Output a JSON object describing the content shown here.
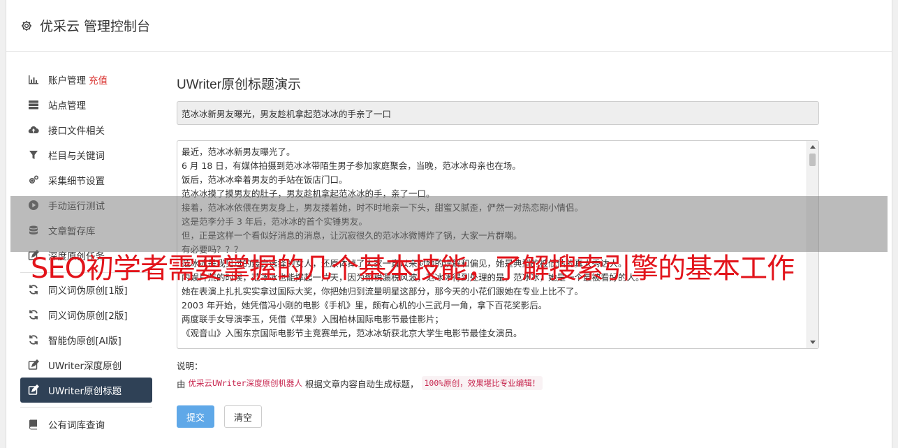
{
  "header": {
    "title": "优采云 管理控制台"
  },
  "sidebar": {
    "items": [
      {
        "label": "账户管理",
        "extra": "充值",
        "icon": "bar-chart-icon"
      },
      {
        "label": "站点管理",
        "icon": "server-icon"
      },
      {
        "label": "接口文件相关",
        "icon": "cloud-upload-icon"
      },
      {
        "label": "栏目与关键词",
        "icon": "filter-icon"
      },
      {
        "label": "采集细节设置",
        "icon": "gears-icon"
      },
      {
        "label": "手动运行测试",
        "icon": "play-circle-icon"
      },
      {
        "label": "文章暂存库",
        "icon": "database-icon"
      },
      {
        "label": "深度原创任务",
        "icon": "edit-icon"
      },
      {
        "label": "同义词伪原创[1版]",
        "icon": "refresh-icon"
      },
      {
        "label": "同义词伪原创[2版]",
        "icon": "refresh-icon"
      },
      {
        "label": "智能伪原创[AI版]",
        "icon": "refresh-icon"
      },
      {
        "label": "UWriter深度原创",
        "icon": "edit-icon"
      },
      {
        "label": "UWriter原创标题",
        "icon": "edit-icon",
        "active": true
      },
      {
        "label": "公有词库查询",
        "icon": "book-icon"
      }
    ]
  },
  "main": {
    "heading": "UWriter原创标题演示",
    "title_value": "范冰冰新男友曝光，男友趁机拿起范冰冰的手亲了一口",
    "body_lines": [
      "最近，范冰冰新男友曝光了。",
      "6 月 18 日，有媒体拍摄到范冰冰带陌生男子参加家庭聚会，当晚，范冰冰母亲也在场。",
      "饭后，范冰冰牵着男友的手站在饭店门口。",
      "范冰冰摸了摸男友的肚子，男友趁机拿起范冰冰的手，亲了一口。",
      "接着，范冰冰依偎在男友身上，男友搂着她，时不时地亲一下头，甜蜜又腻歪，俨然一对热恋期小情侣。",
      "这是范李分手 3 年后，范冰冰的首个实锤男友。",
      "但，正是这样一个看似好消息的消息，让沉寂很久的范冰冰微博炸了锅，大家一片群嘲。",
      "有必要吗？？？",
      "范冰冰是我见过的最会选择的女人，还原体掉了大家一直以来对她的误解和偏见，她是典型的被低估的真人秀达人。",
      "内娱片荒的时候，范冰冰也能撑起一片天，因为偷税漏税风波，范冰冰得到处理的是，范冰冰，她是一个最被看好的人。",
      "她在表演上扎扎实实拿过国际大奖，你把她归到流量明星这部分，那今天的小花们跟她在专业上比不了。",
      "2003 年开始，她凭借冯小刚的电影《手机》里，颇有心机的小三武月一角，拿下百花奖影后。",
      "两度联手女导演李玉，凭借《苹果》入围柏林国际电影节最佳影片；",
      "《观音山》入围东京国际电影节主竞赛单元，范冰冰斩获北京大学生电影节最佳女演员。"
    ],
    "explain_label": "说明：",
    "explain_prefix": "由",
    "explain_code": "优采云UWriter深度原创机器人",
    "explain_mid": "根据文章内容自动生成标题，",
    "explain_badge": "100%原创，效果堪比专业编辑！",
    "submit_label": "提交",
    "clear_label": "清空"
  },
  "overlay": {
    "headline": "SEO初学者需要掌握的几个基本技能，了解搜索引擎的基本工作"
  },
  "colors": {
    "active_nav": "#2f4156",
    "primary_button": "#5fa8e8",
    "recharge": "#d9322f",
    "headline": "#e2141b"
  }
}
